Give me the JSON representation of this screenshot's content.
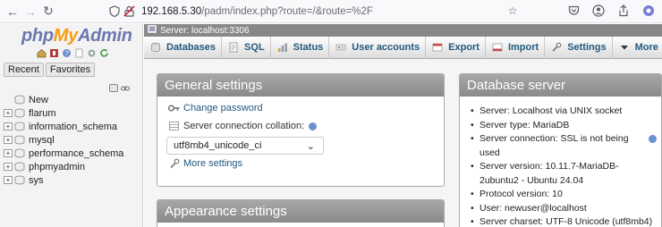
{
  "browser": {
    "url_host": "192.168.5.30",
    "url_path": "/padm/index.php?route=/&route=%2F"
  },
  "sidebar": {
    "logo": {
      "php": "php",
      "my": "My",
      "admin": "Admin"
    },
    "tabs": [
      "Recent",
      "Favorites"
    ],
    "new_label": "New",
    "databases": [
      "flarum",
      "information_schema",
      "mysql",
      "performance_schema",
      "phpmyadmin",
      "sys"
    ]
  },
  "server_bar": {
    "label": "Server: localhost:3306"
  },
  "tabs": [
    {
      "label": "Databases",
      "icon": "databases-icon"
    },
    {
      "label": "SQL",
      "icon": "sql-icon"
    },
    {
      "label": "Status",
      "icon": "status-icon"
    },
    {
      "label": "User accounts",
      "icon": "user-accounts-icon"
    },
    {
      "label": "Export",
      "icon": "export-icon"
    },
    {
      "label": "Import",
      "icon": "import-icon"
    },
    {
      "label": "Settings",
      "icon": "settings-icon"
    },
    {
      "label": "More",
      "icon": "more-icon"
    }
  ],
  "general_settings": {
    "title": "General settings",
    "change_password": "Change password",
    "collation_label": "Server connection collation:",
    "collation_value": "utf8mb4_unicode_ci",
    "more_settings": "More settings"
  },
  "database_server": {
    "title": "Database server",
    "items": [
      "Server: Localhost via UNIX socket",
      "Server type: MariaDB",
      "Server connection: SSL is not being used",
      "Server version: 10.11.7-MariaDB-2ubuntu2 - Ubuntu 24.04",
      "Protocol version: 10",
      "User: newuser@localhost",
      "Server charset: UTF-8 Unicode (utf8mb4)"
    ]
  },
  "appearance_settings": {
    "title": "Appearance settings"
  },
  "colors": {
    "logo_blue": "#6c78af",
    "logo_orange": "#f89c0e",
    "link": "#235a81",
    "panel_head": "#8a8a8a"
  }
}
